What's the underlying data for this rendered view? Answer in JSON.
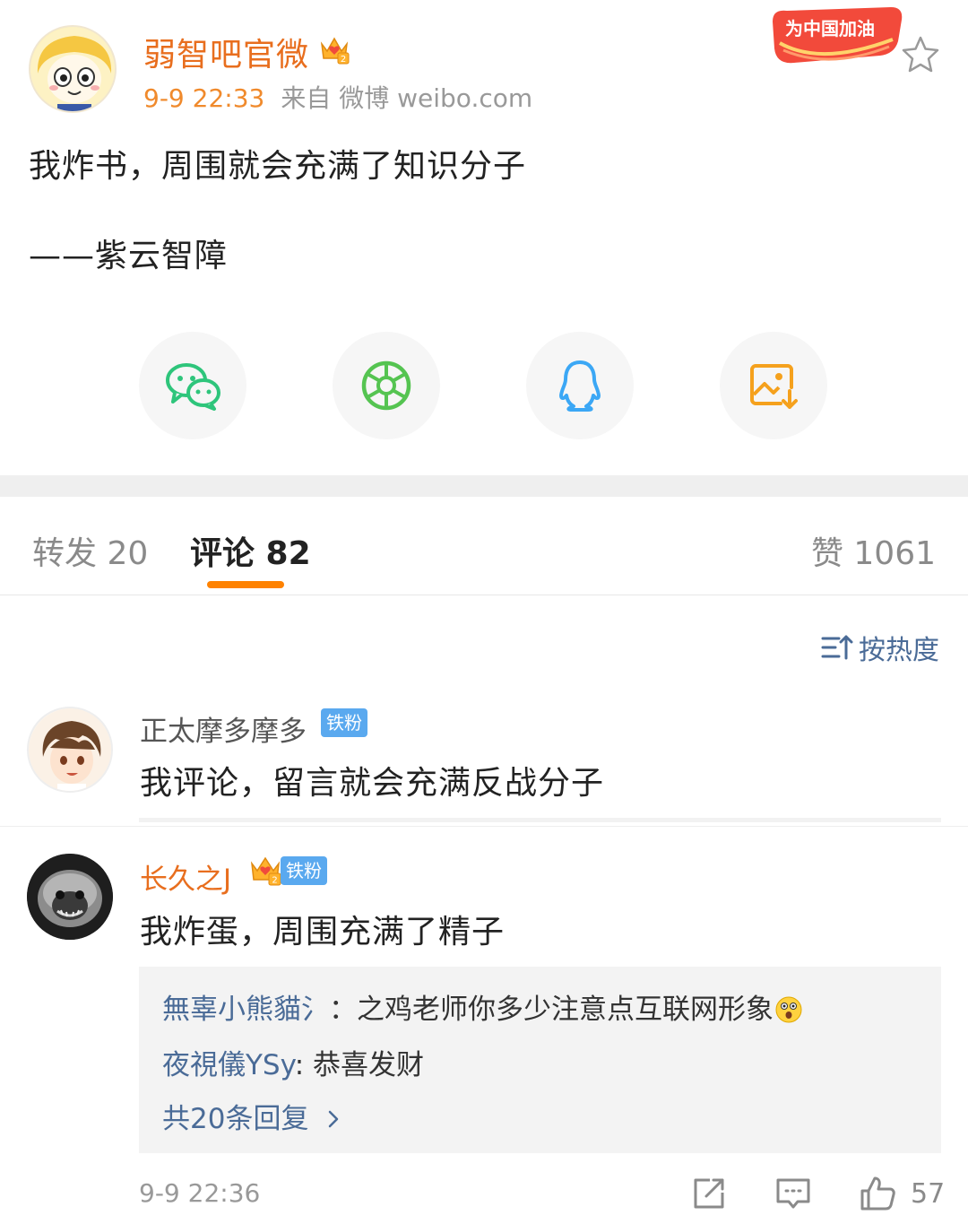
{
  "post": {
    "author_name": "弱智吧官微",
    "time": "9-9 22:33",
    "source": "来自 微博 weibo.com",
    "cheer_badge": "为中国加油",
    "text_line1": "我炸书，周围就会充满了知识分子",
    "text_line2": "——紫云智障"
  },
  "share": {
    "icons": [
      "wechat-icon",
      "moments-icon",
      "qq-icon",
      "save-image-icon"
    ]
  },
  "tabs": {
    "repost": "转发 20",
    "comments": "评论 82",
    "likes": "赞 1061"
  },
  "sort": {
    "label": "按热度"
  },
  "comments": [
    {
      "name": "正太摩多摩多",
      "badge": "铁粉",
      "text": "我评论，留言就会充满反战分子"
    },
    {
      "name": "长久之J",
      "badge": "铁粉",
      "text": "我炸蛋，周围充满了精子",
      "replies": [
        {
          "name": "無辜小熊貓氵",
          "text": "：之鸡老师你多少注意点互联网形象"
        },
        {
          "name": "夜視儀YSy",
          "text": ": 恭喜发财"
        }
      ],
      "more_replies": "共20条回复",
      "time": "9-9 22:36",
      "likes": "57"
    }
  ],
  "colors": {
    "brand_orange": "#ff8200",
    "username_orange": "#e86e1e",
    "link_blue": "#4a6b97",
    "tiefen_blue": "#5aa9ef"
  }
}
